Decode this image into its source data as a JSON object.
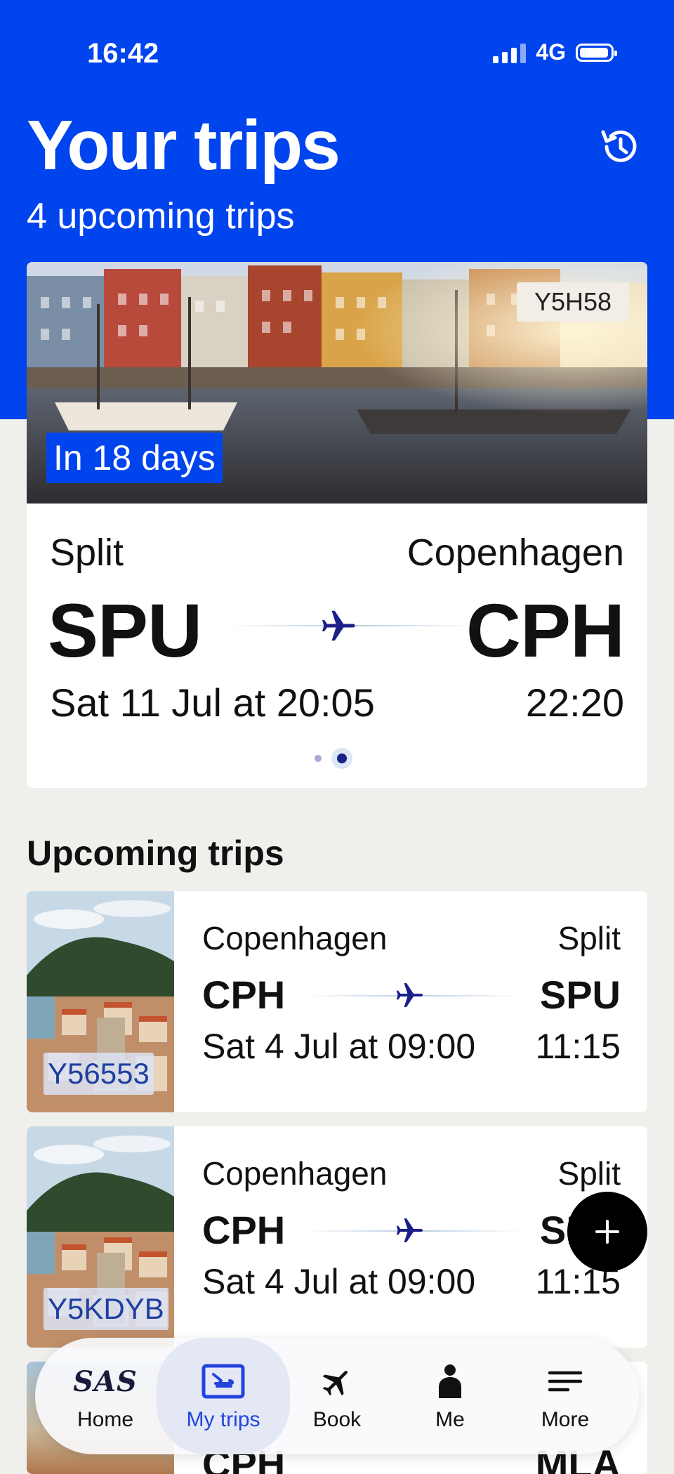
{
  "status_bar": {
    "time": "16:42",
    "network": "4G"
  },
  "header": {
    "title": "Your trips",
    "subtitle": "4 upcoming trips"
  },
  "featured_trip": {
    "booking_ref": "Y5H58",
    "countdown": "In 18 days",
    "from_city": "Split",
    "from_code": "SPU",
    "to_city": "Copenhagen",
    "to_code": "CPH",
    "departure": "Sat 11 Jul at 20:05",
    "arrival": "22:20"
  },
  "upcoming": {
    "title": "Upcoming trips",
    "trips": [
      {
        "booking_ref": "Y56553",
        "from_city": "Copenhagen",
        "from_code": "CPH",
        "to_city": "Split",
        "to_code": "SPU",
        "departure": "Sat 4 Jul at 09:00",
        "arrival": "11:15"
      },
      {
        "booking_ref": "Y5KDYB",
        "from_city": "Copenhagen",
        "from_code": "CPH",
        "to_city": "Split",
        "to_code": "SPU",
        "departure": "Sat 4 Jul at 09:00",
        "arrival": "11:15"
      },
      {
        "from_code": "CPH",
        "to_code": "MLA"
      }
    ]
  },
  "fab": {
    "icon": "plus-icon"
  },
  "tabbar": {
    "items": [
      {
        "label": "Home",
        "icon": "sas-logo",
        "logo_text": "SAS"
      },
      {
        "label": "My trips",
        "icon": "boarding-pass-icon",
        "active": true
      },
      {
        "label": "Book",
        "icon": "airplane-icon"
      },
      {
        "label": "Me",
        "icon": "person-icon"
      },
      {
        "label": "More",
        "icon": "menu-icon"
      }
    ]
  },
  "colors": {
    "brand_blue": "#0044ee",
    "plane_navy": "#1b1f8a",
    "active_tab": "#2244dd"
  }
}
